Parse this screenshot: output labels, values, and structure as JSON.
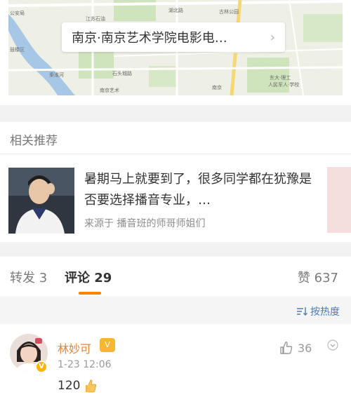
{
  "map": {
    "card_text": "南京·南京艺术学院电影电…",
    "chevron": "›",
    "labels": [
      "公安局",
      "鼓楼区",
      "江苏石油",
      "南艺",
      "秦淮河",
      "南京艺术",
      "石头城路",
      "湖北路",
      "古林公园",
      "南京",
      "东大·理工",
      "人民军人·学校"
    ]
  },
  "related": {
    "title": "相关推荐",
    "item": {
      "text": "暑期马上就要到了，很多同学都在犹豫是否要选择播音专业，…",
      "source": "来源于 播音班的师哥师姐们"
    }
  },
  "tabs": {
    "repost": "转发 3",
    "comment_label": "评论",
    "comment_count": "29",
    "like": "赞 637"
  },
  "sort": {
    "icon": "sort-icon",
    "label": "按热度"
  },
  "comment": {
    "name": "林妙可",
    "badge": "V",
    "time": "1-23 12:06",
    "text": "120",
    "likes": "36",
    "menu": "⌄"
  },
  "colors": {
    "accent": "#ff8200",
    "link": "#4e7bb3",
    "name": "#e6863a"
  }
}
